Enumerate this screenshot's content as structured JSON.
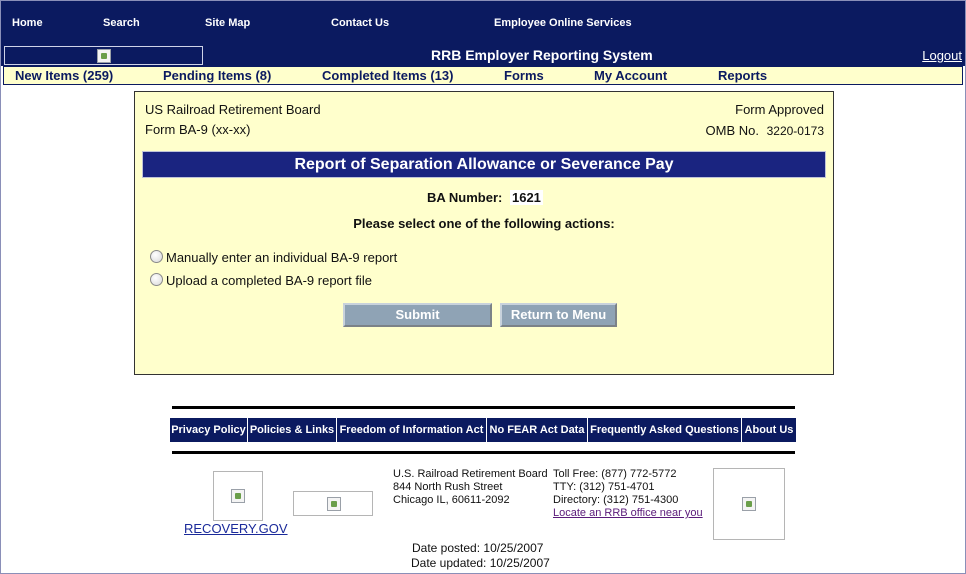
{
  "topnav": {
    "home": "Home",
    "search": "Search",
    "sitemap": "Site Map",
    "contact": "Contact Us",
    "eos": "Employee Online Services"
  },
  "titlebar": {
    "system_title": "RRB Employer Reporting System",
    "logout": "Logout"
  },
  "menu": {
    "new_items": "New Items (259)",
    "pending_items": "Pending Items (8)",
    "completed_items": "Completed Items (13)",
    "forms": "Forms",
    "my_account": "My Account",
    "reports": "Reports"
  },
  "form": {
    "agency": "US Railroad Retirement Board",
    "form_id": "Form BA-9  (xx-xx)",
    "approved": "Form Approved",
    "omb_label": "OMB No.",
    "omb_number": "3220-0173",
    "title": "Report of Separation Allowance or Severance Pay",
    "ba_label": "BA Number:",
    "ba_value": "1621",
    "prompt": "Please select one of the following actions:",
    "option1": "Manually enter an individual BA-9 report",
    "option2": "Upload a completed BA-9 report file",
    "submit": "Submit",
    "return": "Return to Menu"
  },
  "footer": {
    "links": {
      "privacy": "Privacy Policy",
      "policies": "Policies & Links",
      "foia": "Freedom of Information Act",
      "nofear": "No FEAR Act Data",
      "faq": "Frequently Asked Questions",
      "about": "About Us"
    },
    "recovery": "RECOVERY.GOV",
    "address": {
      "line1": "U.S. Railroad Retirement Board",
      "line2": "844 North Rush Street",
      "line3": "Chicago IL, 60611-2092"
    },
    "phones": {
      "tollfree": "Toll Free: (877) 772-5772",
      "tty": "TTY: (312) 751-4701",
      "directory": "Directory: (312) 751-4300",
      "locate": "Locate an RRB office near you"
    },
    "date_posted_label": "Date posted:",
    "date_posted": "10/25/2007",
    "date_updated_label": "Date updated:",
    "date_updated": "10/25/2007"
  },
  "colors": {
    "navy": "#0b1a60",
    "form_bg": "#ffffcc",
    "header_bar": "#1a2480",
    "button": "#8fa3b5"
  },
  "icons": {
    "broken_image": "broken-image-icon"
  }
}
